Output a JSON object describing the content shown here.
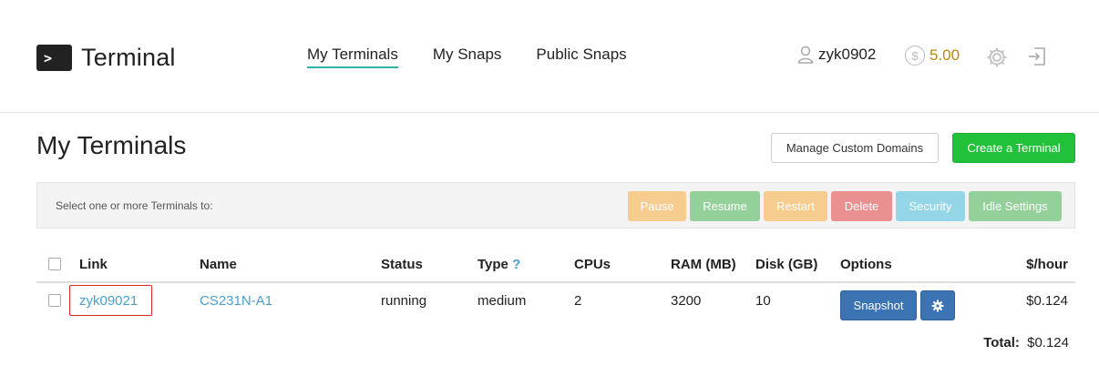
{
  "logo": {
    "mark": ">",
    "text": "Terminal"
  },
  "nav": {
    "items": [
      "My Terminals",
      "My Snaps",
      "Public Snaps"
    ],
    "active": "My Terminals"
  },
  "user": {
    "icon": "user-icon",
    "name": "zyk0902"
  },
  "credit": {
    "icon": "dollar-coin-icon",
    "symbol": "$",
    "amount": "5.00"
  },
  "page_title": "My Terminals",
  "buttons": {
    "manage_domains": "Manage Custom Domains",
    "create": "Create a Terminal"
  },
  "action_bar": {
    "label": "Select one or more Terminals to:",
    "actions": [
      "Pause",
      "Resume",
      "Restart",
      "Delete",
      "Security",
      "Idle Settings"
    ]
  },
  "table": {
    "headers": {
      "link": "Link",
      "name": "Name",
      "status": "Status",
      "type": "Type",
      "type_help": "?",
      "cpus": "CPUs",
      "ram": "RAM (MB)",
      "disk": "Disk (GB)",
      "options": "Options",
      "price": "$/hour"
    },
    "rows": [
      {
        "link": "zyk09021",
        "name": "CS231N-A1",
        "status": "running",
        "type": "medium",
        "cpus": "2",
        "ram": "3200",
        "disk": "10",
        "snapshot": "Snapshot",
        "price": "$0.124"
      }
    ],
    "total_label": "Total:",
    "total_value": "$0.124"
  },
  "colors": {
    "accent": "#2fb3a6",
    "create": "#22c13a",
    "snapshot": "#3b73b3",
    "credit": "#b58a0b",
    "link": "#4a9fd0"
  }
}
